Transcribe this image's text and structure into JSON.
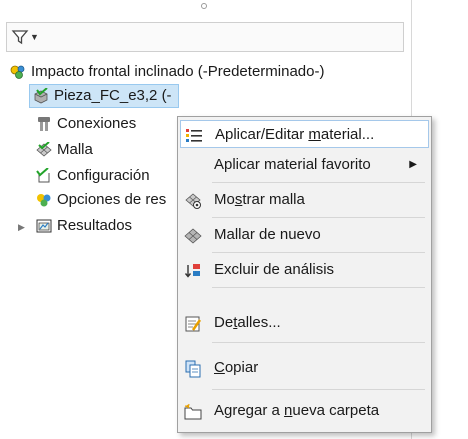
{
  "colors": {
    "selection_bg": "#cde5f7",
    "selection_border": "#99c9ef",
    "menu_bg": "#f2f2f2",
    "menu_hover_border": "#a5c8ea"
  },
  "tree": {
    "study": {
      "label": "Impacto frontal inclinado (-Predeterminado-)",
      "icon": "study-icon"
    },
    "part": {
      "label": "Pieza_FC_e3,2 (-",
      "icon": "part-icon"
    },
    "connections": {
      "label": "Conexiones",
      "icon": "connections-icon"
    },
    "mesh": {
      "label": "Malla",
      "icon": "mesh-icon"
    },
    "config": {
      "label": "Configuración",
      "icon": "configuration-icon"
    },
    "options": {
      "label": "Opciones de res",
      "icon": "result-options-icon"
    },
    "results": {
      "label": "Resultados",
      "icon": "results-folder-icon"
    }
  },
  "menu": {
    "apply_edit_material": {
      "pre": "Aplicar/Editar ",
      "mnemonic": "m",
      "post": "aterial...",
      "icon": "material-list-icon"
    },
    "apply_favorite_material": {
      "label": "Aplicar material favorito",
      "icon": "submenu-arrow"
    },
    "show_mesh": {
      "pre": "Mo",
      "mnemonic": "s",
      "post": "trar malla",
      "icon": "show-mesh-icon"
    },
    "remesh": {
      "label": "Mallar de nuevo",
      "icon": "remesh-icon"
    },
    "exclude_analysis": {
      "label": "Excluir de análisis",
      "icon": "exclude-analysis-icon"
    },
    "details": {
      "pre": "De",
      "mnemonic": "t",
      "post": "alles...",
      "icon": "details-icon"
    },
    "copy": {
      "pre": "",
      "mnemonic": "C",
      "post": "opiar",
      "icon": "copy-icon"
    },
    "add_folder": {
      "pre": "Agregar a ",
      "mnemonic": "n",
      "post": "ueva carpeta",
      "icon": "new-folder-icon"
    }
  }
}
